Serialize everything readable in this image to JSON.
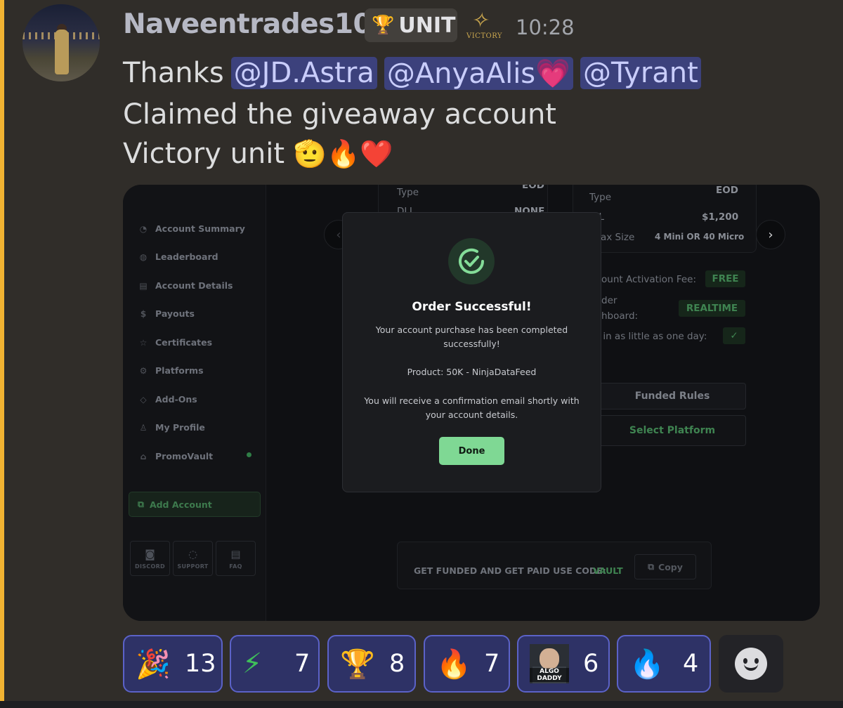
{
  "message": {
    "username": "Naveentrades100",
    "tag": {
      "icon": "🏆",
      "label": "UNIT"
    },
    "badge_logo_text": "VICTORY",
    "timestamp": "10:28",
    "lines": {
      "thanks": "Thanks",
      "mentions": [
        "@JD.Astra",
        "@AnyaAlis💗",
        "@Tyrant"
      ],
      "line2": "Claimed the giveaway account",
      "line3": "Victory unit",
      "line3_emojis": "🫡🔥❤️"
    }
  },
  "screenshot": {
    "sidebar": {
      "items": [
        {
          "label": "Account Summary",
          "icon": "gauge-icon"
        },
        {
          "label": "Leaderboard",
          "icon": "globe-icon"
        },
        {
          "label": "Account Details",
          "icon": "document-icon"
        },
        {
          "label": "Payouts",
          "icon": "dollar-icon"
        },
        {
          "label": "Certificates",
          "icon": "star-icon"
        },
        {
          "label": "Platforms",
          "icon": "gear-icon"
        },
        {
          "label": "Add-Ons",
          "icon": "tag-icon"
        },
        {
          "label": "My Profile",
          "icon": "user-icon"
        },
        {
          "label": "PromoVault",
          "icon": "lock-icon"
        }
      ],
      "add_account": "Add Account",
      "footer": [
        "DISCORD",
        "SUPPORT",
        "FAQ"
      ]
    },
    "background": {
      "left_card": {
        "type_label": "Type",
        "type_value": "EOD",
        "dll_label": "DLL",
        "dll_value": "NONE"
      },
      "right_card": {
        "type_label_partial": "Type",
        "type_value": "EOD",
        "dll_label_partial": "LL",
        "dll_value": "$1,200",
        "max_label_partial": "ax Size",
        "max_value": "4 Mini OR 40 Micro"
      },
      "activation_label": "ount Activation Fee:",
      "activation_value": "FREE",
      "dashboard_label_1": "der",
      "dashboard_label_2": "hboard:",
      "dashboard_value": "REALTIME",
      "oneday_label": "s in as little as one day:",
      "oneday_value": "✓",
      "funded_rules": "Funded Rules",
      "select_platform": "Select Platform",
      "promo_text": "GET FUNDED AND GET PAID USE CODE:",
      "promo_code": "VAULT",
      "copy_label": "Copy"
    },
    "modal": {
      "title": "Order Successful!",
      "message": "Your account purchase has been completed successfully!",
      "product": "Product: 50K - NinjaDataFeed",
      "confirmation": "You will receive a confirmation email shortly with your account details.",
      "done": "Done"
    }
  },
  "reactions": [
    {
      "emoji": "🎉",
      "count": "13"
    },
    {
      "emoji": "⚡",
      "count": "7"
    },
    {
      "emoji": "🏆",
      "count": "8"
    },
    {
      "emoji": "🔥",
      "count": "7"
    },
    {
      "emoji": "ALGO DADDY",
      "count": "6"
    },
    {
      "emoji": "🔥",
      "count": "4"
    }
  ],
  "colors": {
    "accent_bar": "#f0b232",
    "mention_bg": "#3c417c",
    "reaction_border": "#5b62c8",
    "success_green": "#7fd894"
  }
}
